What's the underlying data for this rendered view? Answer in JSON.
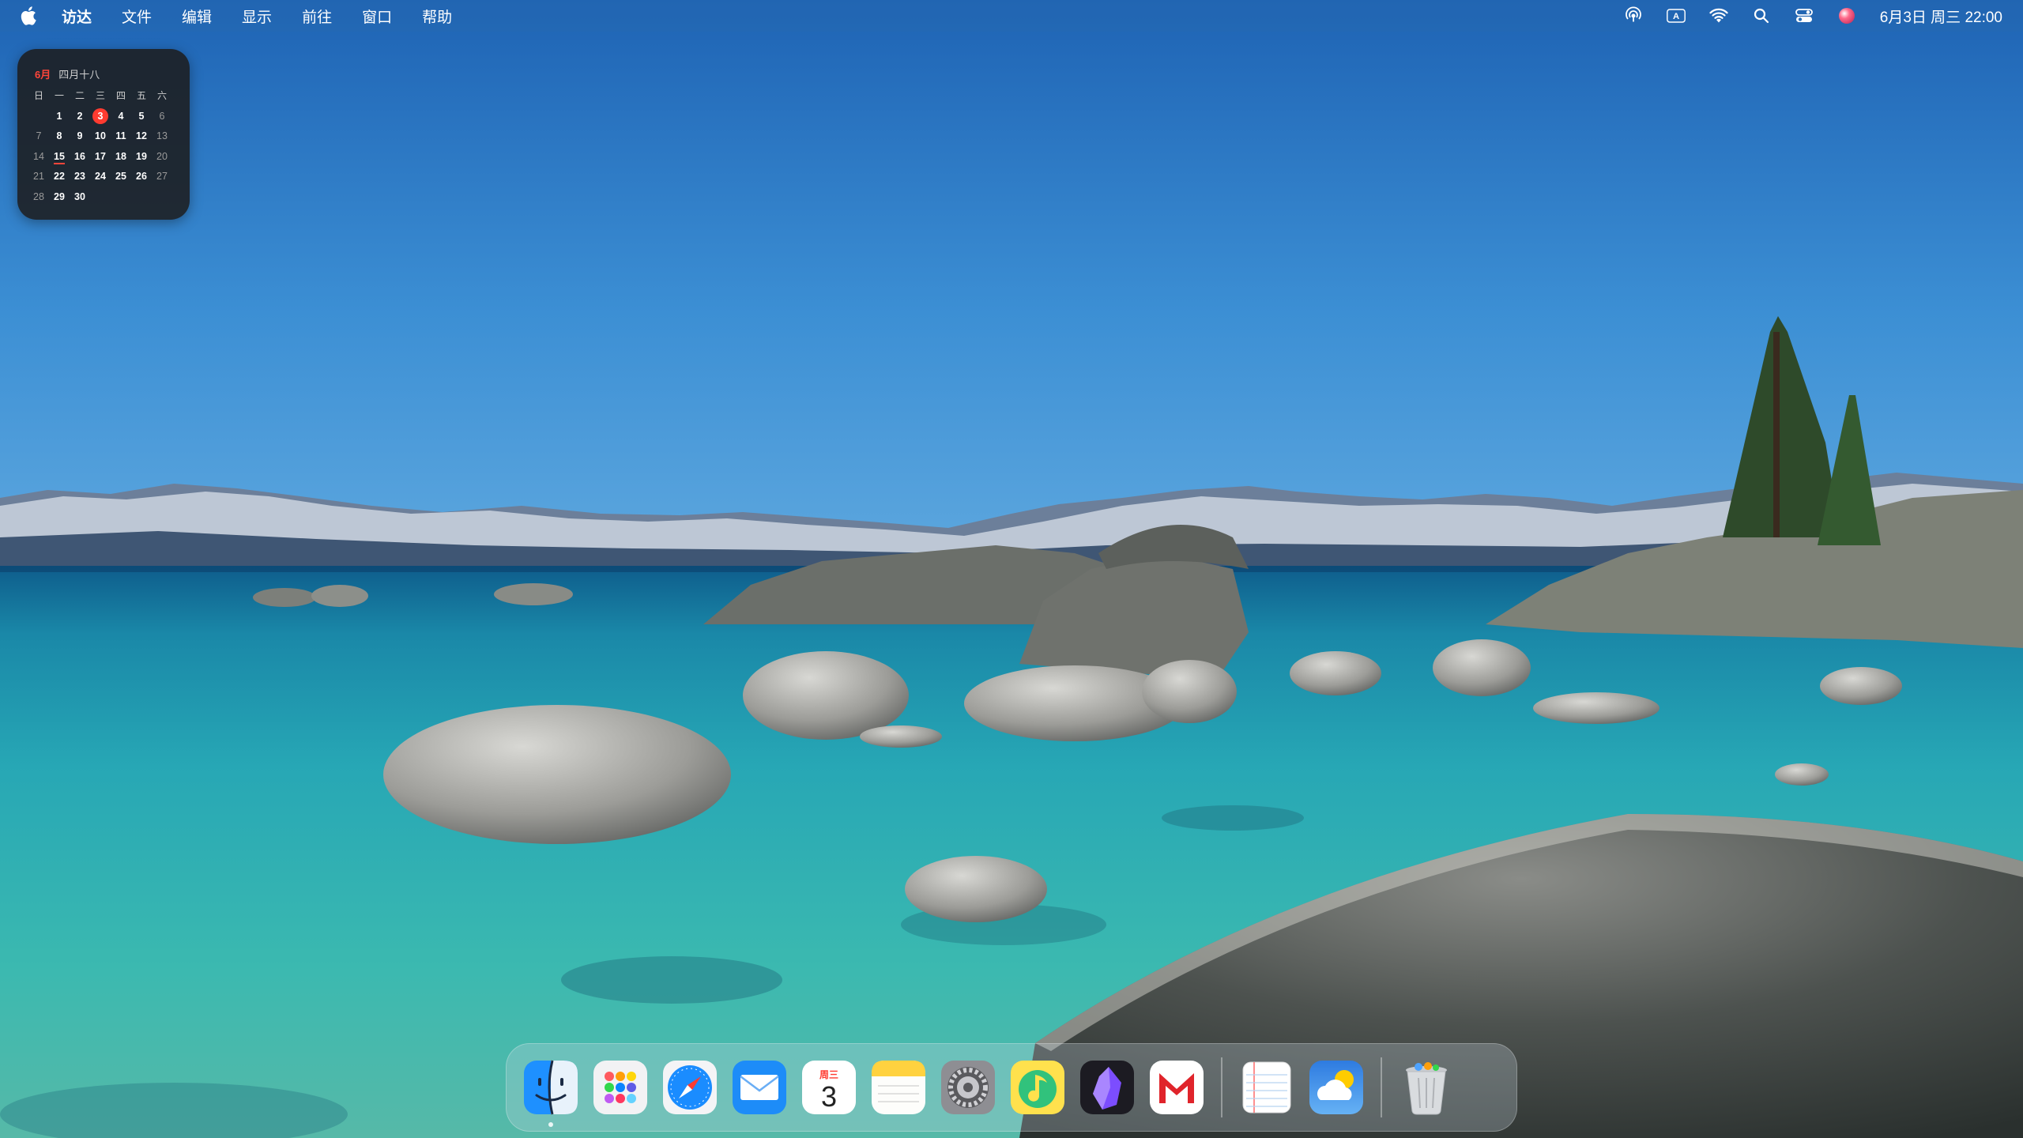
{
  "menubar": {
    "app_name": "访达",
    "menus": [
      "文件",
      "编辑",
      "显示",
      "前往",
      "窗口",
      "帮助"
    ],
    "clock": "6月3日 周三  22:00",
    "status_icons": [
      "airdrop-icon",
      "input-method-icon",
      "wifi-icon",
      "search-icon",
      "control-center-icon",
      "siri-icon"
    ],
    "input_method_label": "A"
  },
  "calendar": {
    "month_label": "6月",
    "lunar_label": "四月十八",
    "weekdays": [
      "日",
      "一",
      "二",
      "三",
      "四",
      "五",
      "六"
    ],
    "weeks": [
      [
        "",
        "1",
        "2",
        "3",
        "4",
        "5",
        "6"
      ],
      [
        "7",
        "8",
        "9",
        "10",
        "11",
        "12",
        "13"
      ],
      [
        "14",
        "15",
        "16",
        "17",
        "18",
        "19",
        "20"
      ],
      [
        "21",
        "22",
        "23",
        "24",
        "25",
        "26",
        "27"
      ],
      [
        "28",
        "29",
        "30",
        "",
        "",
        "",
        ""
      ]
    ],
    "today": "3",
    "holiday": "15",
    "accent_color": "#ff3b30"
  },
  "dock": {
    "apps": [
      {
        "name": "Finder",
        "icon": "finder-icon",
        "running": true
      },
      {
        "name": "Launchpad",
        "icon": "launchpad-icon"
      },
      {
        "name": "Safari",
        "icon": "safari-icon"
      },
      {
        "name": "Mail",
        "icon": "mail-icon"
      },
      {
        "name": "Calendar",
        "icon": "calendar-icon",
        "weekday": "周三",
        "day": "3"
      },
      {
        "name": "Notes",
        "icon": "notes-icon"
      },
      {
        "name": "System Settings",
        "icon": "system-settings-icon"
      },
      {
        "name": "QQ Music",
        "icon": "qq-music-icon"
      },
      {
        "name": "Obsidian",
        "icon": "obsidian-icon"
      },
      {
        "name": "Mail app M",
        "icon": "gmail-m-icon"
      },
      {
        "name": "TextEdit",
        "icon": "textedit-icon"
      },
      {
        "name": "Weather",
        "icon": "weather-icon"
      },
      {
        "name": "Trash",
        "icon": "trash-icon"
      }
    ]
  }
}
